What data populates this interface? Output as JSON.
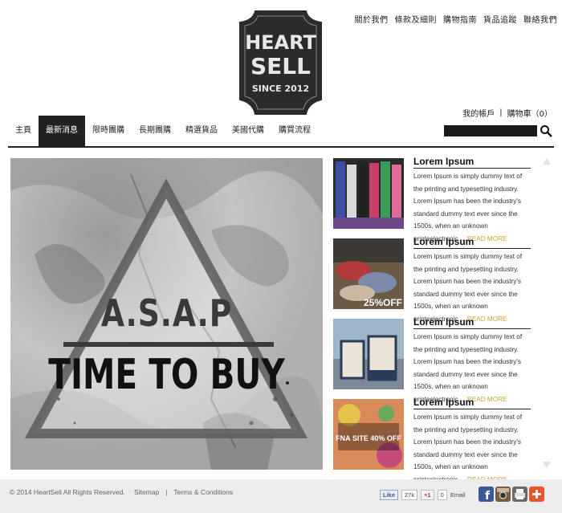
{
  "top_links": [
    "關於我們",
    "條款及細則",
    "購物指南",
    "貨品追蹤",
    "聯絡我們"
  ],
  "logo": {
    "line1": "HEART",
    "line2": "SELL",
    "line3": "SINCE 2012"
  },
  "account": {
    "my_account": "我的帳戶",
    "separator": "|",
    "cart": "購物車（0）"
  },
  "nav": {
    "items": [
      "主頁",
      "最新消息",
      "限時團購",
      "長期團購",
      "精選貨品",
      "美國代購",
      "購買流程"
    ],
    "active_index": 1
  },
  "search": {
    "placeholder": ""
  },
  "hero": {
    "line1": "A.S.A.P",
    "line2": "TIME TO BUY"
  },
  "articles": [
    {
      "title": "Lorem Ipsum",
      "body": "Lorem Ipsum is simply dummy text of the printing and typesetting industry. Lorem Ipsum has been the industry's standard dummy text ever since the 1500s, when an unknown printeelectronic ...",
      "more": "READ MORE"
    },
    {
      "title": "Lorem Ipsum",
      "body": "Lorem Ipsum is simply dummy text of the printing and typesetting industry. Lorem Ipsum has been the industry's standard dummy text ever since the 1500s, when an unknown printeelectronic ...",
      "more": "READ MORE",
      "badge": "25%OFF"
    },
    {
      "title": "Lorem Ipsum",
      "body": "Lorem Ipsum is simply dummy text of the printing and typesetting industry. Lorem Ipsum has been the industry's standard dummy text ever since the 1500s, when an unknown printeelectronic ...",
      "more": "READ MORE"
    },
    {
      "title": "Lorem Ipsum",
      "body": "Lorem Ipsum is simply dummy text of the printing and typesetting industry. Lorem Ipsum has been the industry's standard dummy text ever since the 1500s, when an unknown printeelectronic ...",
      "more": "READ MORE",
      "badge": "FNA SITE 40% OFF"
    }
  ],
  "footer": {
    "copyright": "© 2014 HeartSell All Rights Reserved.",
    "sitemap": "Sitemap",
    "separator": "|",
    "terms": "Terms & Conditions",
    "fb_like": "Like",
    "fb_count": "27k",
    "gplus": "+1",
    "gplus_count": "0",
    "email": "Email"
  },
  "colors": {
    "accent": "#c8a53c",
    "dark": "#222222",
    "footer_bg": "#ececec"
  },
  "icons": [
    "search-icon",
    "facebook-icon",
    "instagram-icon",
    "print-icon",
    "add-icon"
  ]
}
